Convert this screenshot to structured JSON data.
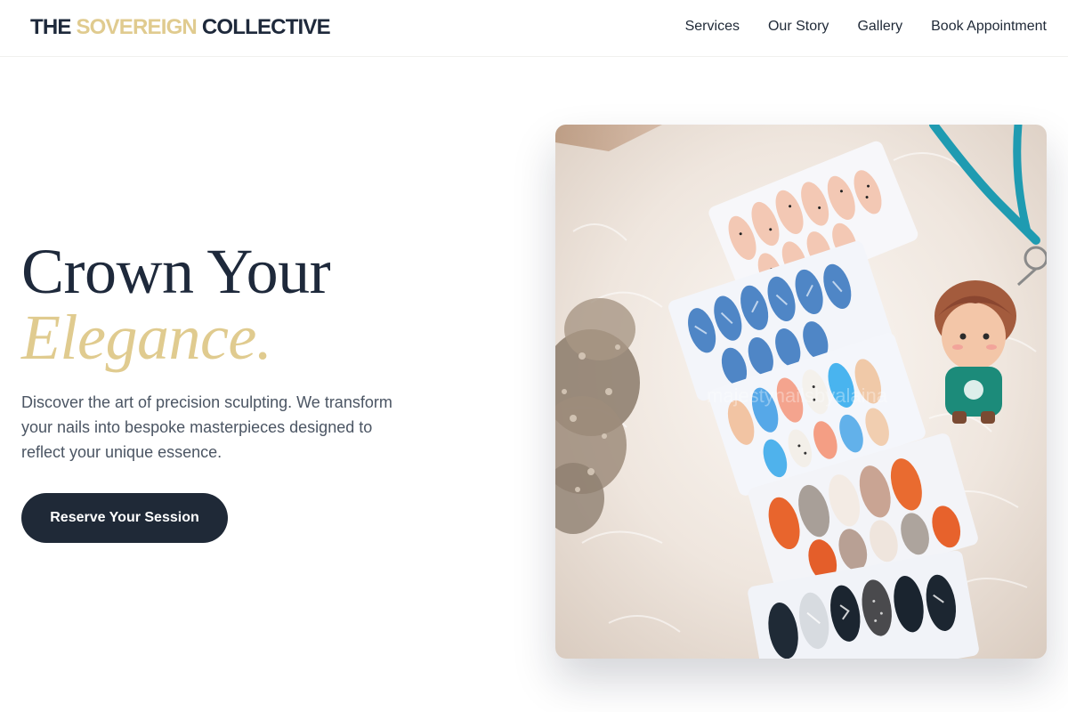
{
  "brand": {
    "part1": "THE ",
    "accent": "SOVEREIGN",
    "part2": " COLLECTIVE",
    "accent_color": "#e0cb8f",
    "dark_color": "#1e293b"
  },
  "nav": {
    "items": [
      {
        "label": "Services"
      },
      {
        "label": "Our Story"
      },
      {
        "label": "Gallery"
      },
      {
        "label": "Book Appointment"
      }
    ]
  },
  "hero": {
    "title_line1": "Crown Your",
    "title_line2": "Elegance.",
    "description": "Discover the art of precision sculpting. We transform your nails into bespoke masterpieces designed to reflect your unique essence.",
    "cta_label": "Reserve Your Session",
    "image_alt": "Press-on nail sets displayed on white fur",
    "watermark": "majestynailsbyalaina"
  }
}
